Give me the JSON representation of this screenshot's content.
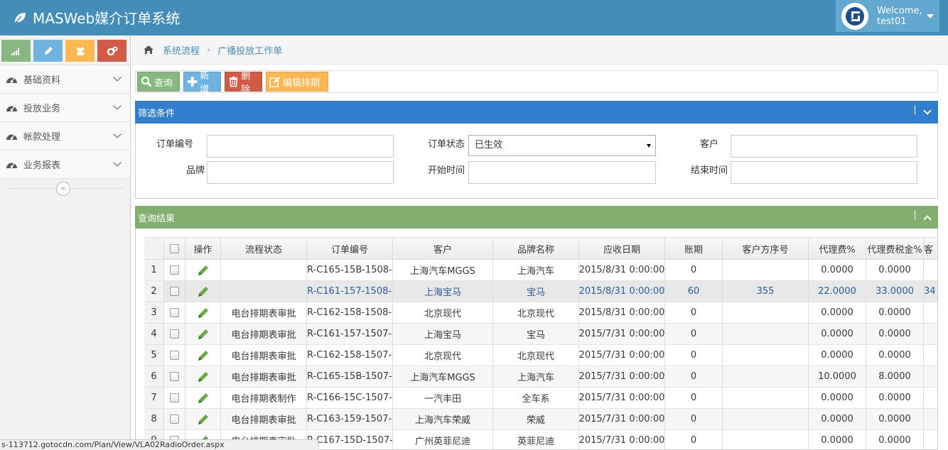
{
  "header": {
    "brand": "MASWeb媒介订单系统",
    "welcome": "Welcome,",
    "username": "test01"
  },
  "sidebar": {
    "shortcuts": [
      "signal-icon",
      "pencil-icon",
      "users-icon",
      "cogs-icon"
    ],
    "items": [
      {
        "label": "基础资料"
      },
      {
        "label": "投放业务"
      },
      {
        "label": "帐款处理"
      },
      {
        "label": "业务报表"
      }
    ],
    "collapse_glyph": "«"
  },
  "breadcrumb": {
    "items": [
      "系统流程",
      "广播投放工作单"
    ]
  },
  "toolbar": {
    "query": "查询",
    "add": "新增",
    "delete": "删除",
    "edit_schedule": "编辑排期"
  },
  "filter": {
    "title": "筛选条件",
    "order_no_label": "订单编号",
    "order_status_label": "订单状态",
    "order_status_value": "已生效",
    "customer_label": "客户",
    "brand_label": "品牌",
    "start_label": "开始时间",
    "end_label": "结束时间"
  },
  "results": {
    "title": "查询结果",
    "columns": [
      "操作",
      "流程状态",
      "订单编号",
      "客户",
      "品牌名称",
      "应收日期",
      "账期",
      "客户方序号",
      "代理费%",
      "代理费税金%",
      "客"
    ],
    "rows": [
      {
        "n": "1",
        "status": "",
        "order": "R-C165-15B-1508-",
        "customer": "上海汽车MGGS",
        "brand": "上海汽车",
        "date": "2015/8/31 0:00:00",
        "term": "0",
        "seq": "",
        "fee": "0.0000",
        "tax": "0.0000",
        "extra": ""
      },
      {
        "n": "2",
        "status": "",
        "order": "R-C161-157-1508-",
        "customer": "上海宝马",
        "brand": "宝马",
        "date": "2015/8/31 0:00:00",
        "term": "60",
        "seq": "355",
        "fee": "22.0000",
        "tax": "33.0000",
        "extra": "34"
      },
      {
        "n": "3",
        "status": "电台排期表审批",
        "order": "R-C162-158-1508-",
        "customer": "北京现代",
        "brand": "北京现代",
        "date": "2015/8/31 0:00:00",
        "term": "0",
        "seq": "",
        "fee": "0.0000",
        "tax": "0.0000",
        "extra": ""
      },
      {
        "n": "4",
        "status": "电台排期表审批",
        "order": "R-C161-157-1507-",
        "customer": "上海宝马",
        "brand": "宝马",
        "date": "2015/7/31 0:00:00",
        "term": "0",
        "seq": "",
        "fee": "0.0000",
        "tax": "0.0000",
        "extra": ""
      },
      {
        "n": "5",
        "status": "电台排期表审批",
        "order": "R-C162-158-1507-",
        "customer": "北京现代",
        "brand": "北京现代",
        "date": "2015/7/31 0:00:00",
        "term": "0",
        "seq": "",
        "fee": "0.0000",
        "tax": "0.0000",
        "extra": ""
      },
      {
        "n": "6",
        "status": "电台排期表审批",
        "order": "R-C165-15B-1507-",
        "customer": "上海汽车MGGS",
        "brand": "上海汽车",
        "date": "2015/7/31 0:00:00",
        "term": "0",
        "seq": "",
        "fee": "10.0000",
        "tax": "8.0000",
        "extra": ""
      },
      {
        "n": "7",
        "status": "电台排期表制作",
        "order": "R-C166-15C-1507-",
        "customer": "一汽丰田",
        "brand": "全车系",
        "date": "2015/7/31 0:00:00",
        "term": "0",
        "seq": "",
        "fee": "0.0000",
        "tax": "0.0000",
        "extra": ""
      },
      {
        "n": "8",
        "status": "电台排期表审批",
        "order": "R-C163-159-1507-",
        "customer": "上海汽车荣威",
        "brand": "荣威",
        "date": "2015/7/31 0:00:00",
        "term": "0",
        "seq": "",
        "fee": "0.0000",
        "tax": "0.0000",
        "extra": ""
      },
      {
        "n": "9",
        "status": "电台排期表审批",
        "order": "R-C167-15D-1507-",
        "customer": "广州英菲尼迪",
        "brand": "英菲尼迪",
        "date": "2015/7/31 0:00:00",
        "term": "0",
        "seq": "",
        "fee": "0.0000",
        "tax": "0.0000",
        "extra": ""
      }
    ]
  },
  "statusbar": {
    "url": "s-113712.gotocdn.com/Plan/View/VLA02RadioOrder.aspx"
  },
  "colors": {
    "header": "#438eb9",
    "filter_head": "#307ecc",
    "result_head": "#82af6f",
    "btn_green": "#87b87f",
    "btn_blue": "#6fb3e0",
    "btn_red": "#d15b47",
    "btn_orange": "#ffb752"
  }
}
